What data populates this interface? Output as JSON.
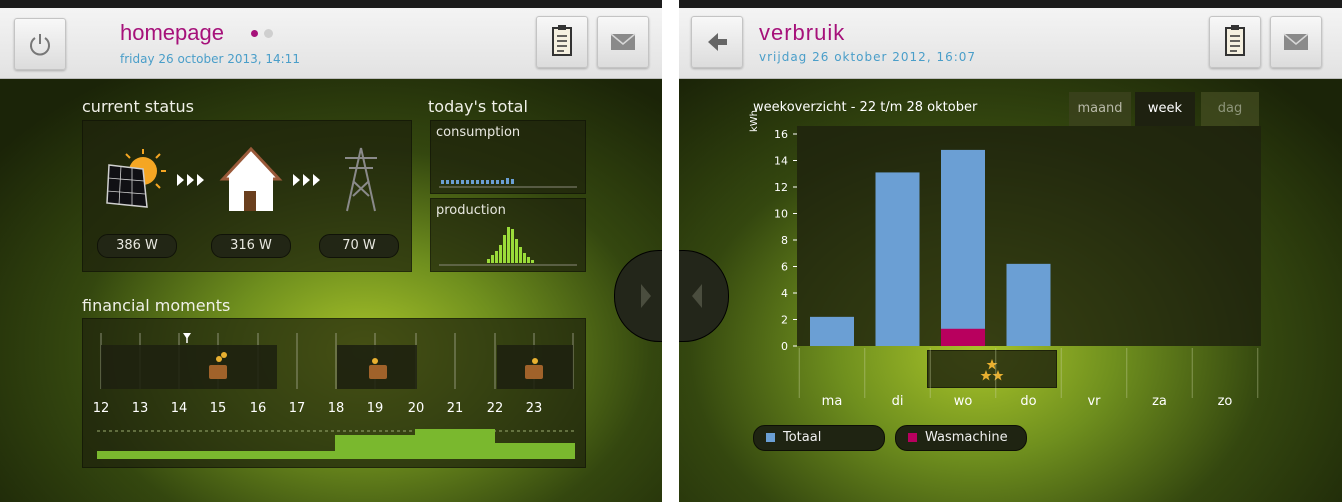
{
  "left": {
    "title": "homepage",
    "date": "friday 26 october 2013, 14:11",
    "icons": {
      "power": "power-icon",
      "clipboard": "clipboard-icon",
      "mail": "mail-icon"
    },
    "current_status": {
      "heading": "current status",
      "solar_value": "386 W",
      "house_value": "316 W",
      "grid_value": "70 W"
    },
    "todays_total": {
      "heading": "today's total",
      "consumption_label": "consumption",
      "production_label": "production"
    },
    "financial": {
      "heading": "financial moments",
      "days": [
        "12",
        "13",
        "14",
        "15",
        "16",
        "17",
        "18",
        "19",
        "20",
        "21",
        "22",
        "23"
      ]
    }
  },
  "right": {
    "title": "verbruik",
    "date": "vrijdag 26 oktober 2012, 16:07",
    "chart_title": "weekoverzicht - 22 t/m 28 oktober",
    "tabs": [
      "maand",
      "week",
      "dag"
    ],
    "active_tab": "week",
    "ylabel": "kWh",
    "legend": [
      "Totaal",
      "Wasmachine"
    ],
    "colors": {
      "totaal": "#6b9fd4",
      "wasmachine": "#b8005e"
    }
  },
  "chart_data": {
    "type": "bar",
    "title": "weekoverzicht - 22 t/m 28 oktober",
    "ylabel": "kWh",
    "ylim": [
      0,
      16
    ],
    "yticks": [
      0,
      2,
      4,
      6,
      8,
      10,
      12,
      14,
      16
    ],
    "categories": [
      "ma",
      "di",
      "wo",
      "do",
      "vr",
      "za",
      "zo"
    ],
    "series": [
      {
        "name": "Totaal",
        "values": [
          2.2,
          13.1,
          14.8,
          6.2,
          0,
          0,
          0
        ]
      },
      {
        "name": "Wasmachine",
        "values": [
          0,
          0,
          1.3,
          0,
          0,
          0,
          0
        ]
      }
    ]
  }
}
